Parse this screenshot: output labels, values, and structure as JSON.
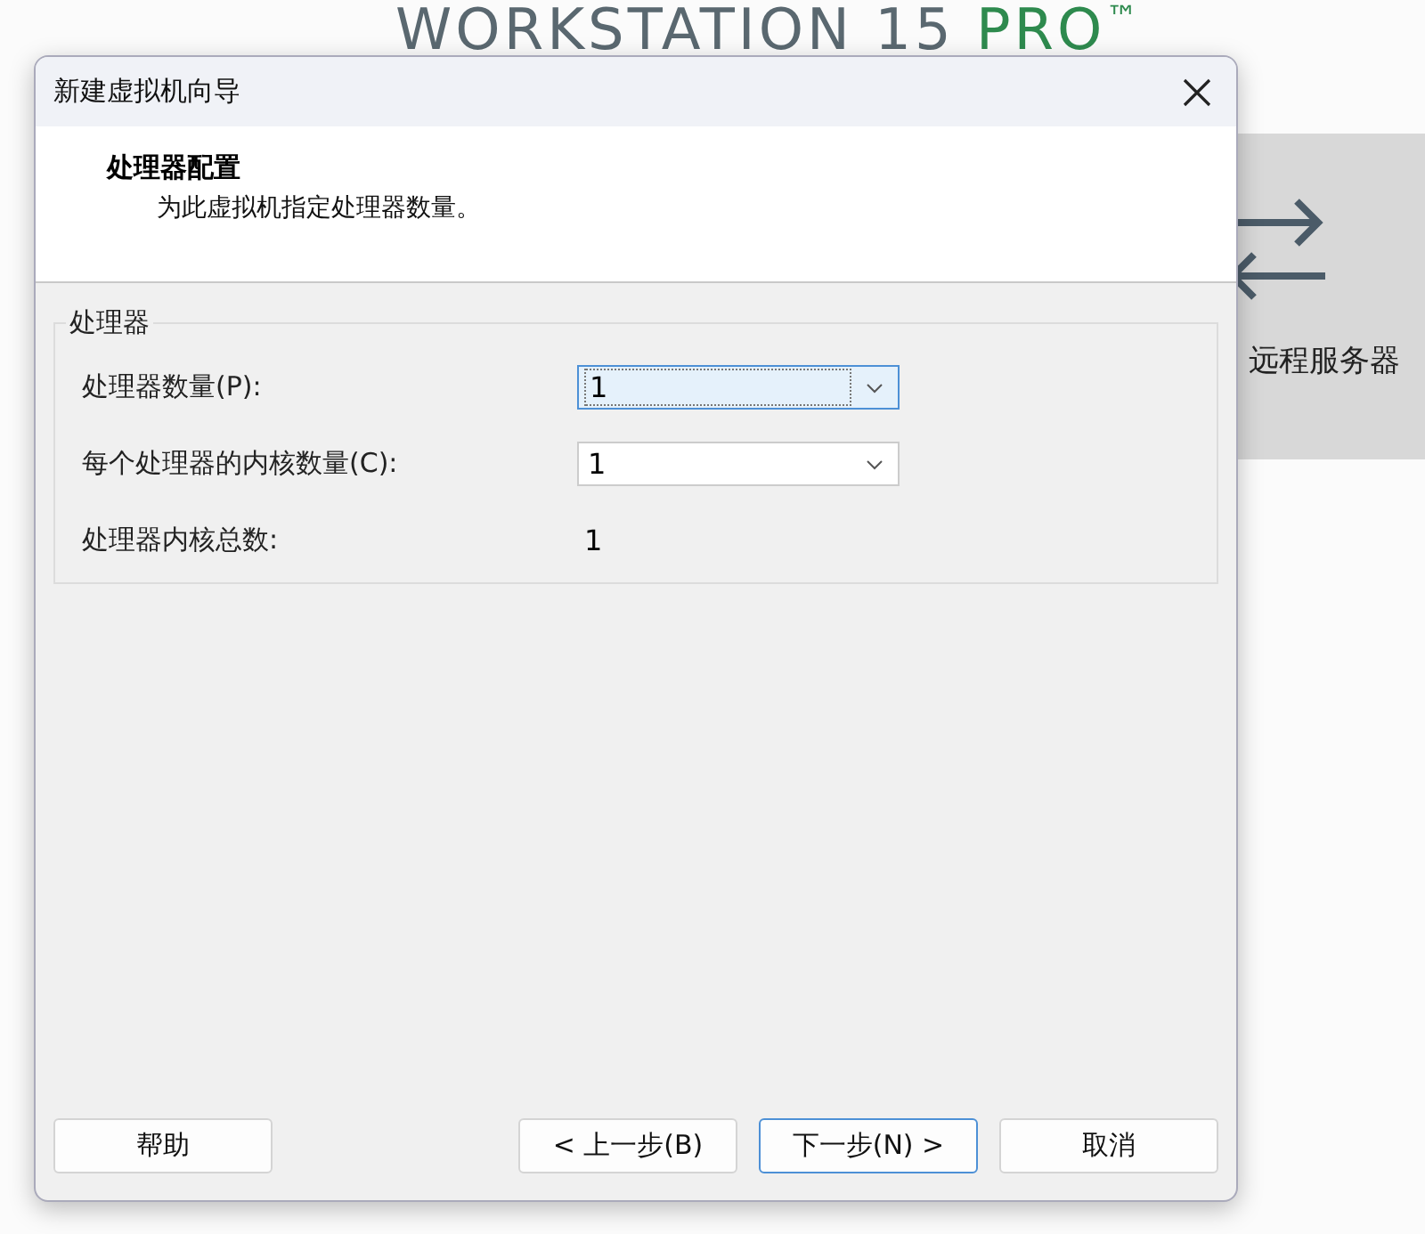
{
  "background": {
    "product_title": {
      "name": "WORKSTATION 15",
      "edition": "PRO",
      "mark": "™"
    },
    "tile": {
      "label": "远程服务器"
    }
  },
  "dialog": {
    "title": "新建虚拟机向导",
    "header": {
      "heading": "处理器配置",
      "description": "为此虚拟机指定处理器数量。"
    },
    "group": {
      "title": "处理器",
      "rows": [
        {
          "kind": "dropdown",
          "label": "处理器数量(P):",
          "value": "1",
          "focused": true
        },
        {
          "kind": "dropdown",
          "label": "每个处理器的内核数量(C):",
          "value": "1",
          "focused": false
        },
        {
          "kind": "readout",
          "label": "处理器内核总数:",
          "value": "1"
        }
      ]
    },
    "buttons": [
      {
        "label": "帮助",
        "default": false
      },
      {
        "label": "< 上一步(B)",
        "default": false
      },
      {
        "label": "下一步(N) >",
        "default": true
      },
      {
        "label": "取消",
        "default": false
      }
    ]
  }
}
